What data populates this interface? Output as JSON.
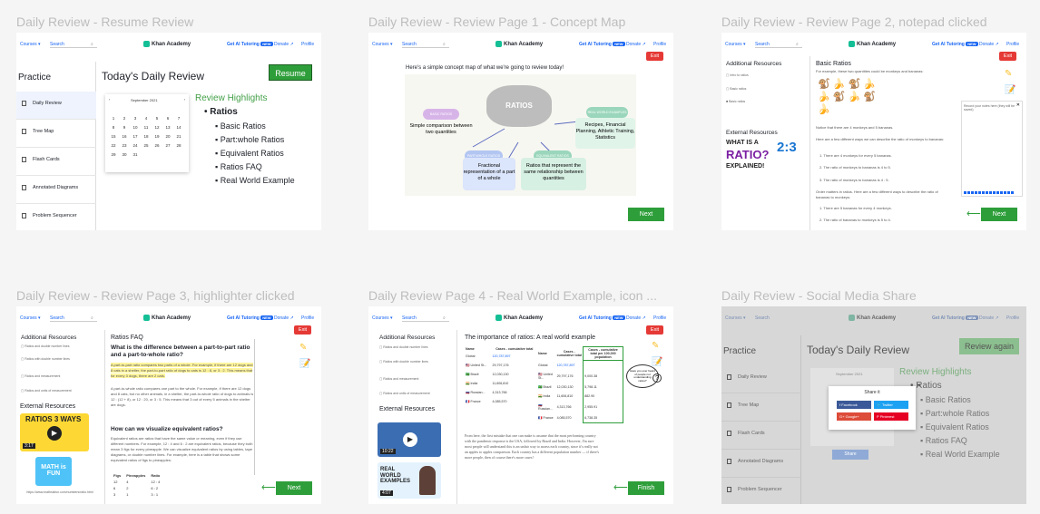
{
  "captions": [
    "Daily Review - Resume Review",
    "Daily Review - Review Page 1 - Concept Map",
    "Daily Review - Review Page 2, notepad clicked",
    "Daily Review - Review Page 3, highlighter clicked",
    "Daily Review Page 4 - Real World Example, icon ...",
    "Daily Review - Social Media Share"
  ],
  "nav": {
    "courses": "Courses ▾",
    "search": "Search",
    "logo": "Khan Academy",
    "ai": "Get AI Tutoring",
    "new": "NEW",
    "donate": "Donate ↗",
    "profile": "Profile"
  },
  "f1": {
    "practice": "Practice",
    "title": "Today's Daily Review",
    "resume": "Resume",
    "side": [
      "Daily Review",
      "Tree Map",
      "Flash Cards",
      "Annotated Diagrams",
      "Problem Sequencer"
    ],
    "month": "September 2021",
    "highlights": "Review Highlights",
    "topic": "Ratios",
    "items": [
      "Basic Ratios",
      "Part:whole Ratios",
      "Equivalent Ratios",
      "Ratios FAQ",
      "Real World Example"
    ],
    "days": [
      "1",
      "2",
      "3",
      "4",
      "5",
      "6",
      "7",
      "8",
      "9",
      "10",
      "11",
      "12",
      "13",
      "14",
      "15",
      "16",
      "17",
      "18",
      "19",
      "20",
      "21",
      "22",
      "23",
      "24",
      "25",
      "26",
      "27",
      "28",
      "29",
      "30",
      "31"
    ]
  },
  "f2": {
    "exit": "Exit",
    "intro": "Here's a simple concept map of what we're going to review today!",
    "center": "RATIOS",
    "n1t": "BASIC RATIOS",
    "n1": "Simple comparison between two quantities",
    "n2t": "PART:WHOLE RATIOS",
    "n2": "Fractional representation of a part of a whole",
    "n3t": "EQUIVALENT RATIOS",
    "n3": "Ratios that represent the same relationship between quantities",
    "n4t": "REAL WORLD EXAMPLES",
    "n4": "Recipes, Financial Planning, Athletic Training, Statistics",
    "next": "Next"
  },
  "f3": {
    "res": "Additional Resources",
    "links": [
      "Intro to ratios",
      "Basic ratios",
      "Basic ratios"
    ],
    "ext": "External Resources",
    "vid1": "WHAT IS A",
    "vid2": "RATIO?",
    "vid3": "EXPLAINED!",
    "vidn": "2:3",
    "title": "Basic Ratios",
    "sub": "For example, these two quantities could be monkeys and bananas:",
    "p1": "Notice that there are 4 monkeys and 5 bananas.",
    "p2": "Here are a few different ways we can describe the ratio of monkeys to bananas:",
    "l1": "1. There are 4 monkeys for every 5 bananas.",
    "l2": "2. The ratio of monkeys to bananas is 4 to 5.",
    "l3": "3. The ratio of monkeys to bananas is 4 : 5.",
    "p3": "Order matters in ratios. Here are a few different ways to describe the ratio of bananas to monkeys:",
    "l4": "1. There are 5 bananas for every 4 monkeys.",
    "l5": "2. The ratio of bananas to monkeys is 5 to 4.",
    "note": "Record your notes here (they will be saved)",
    "exit": "Exit",
    "next": "Next"
  },
  "f4": {
    "res": "Additional Resources",
    "links": [
      "Ratios and double number lines",
      "Ratios with double number lines",
      "Ratios and measurement",
      "Ratios and units of measurement"
    ],
    "ext": "External Resources",
    "vid": "RATIOS 3 WAYS",
    "vidt": "3:17",
    "url": "https://www.mathsisfun.com/numbers/ratio.html",
    "mif": "MATH is FUN",
    "title": "Ratios FAQ",
    "q1": "What is the difference between a part-to-part ratio and a part-to-whole ratio?",
    "a1": "A part-to-part ratio compares two parts of a whole. For example, if there are 12 dogs and 8 cats in a shelter, the part-to-part ratio of dogs to cats is 12 : 8, or 3 : 2. This means that for every 3 dogs, there are 2 cats.",
    "a2": "A part-to-whole ratio compares one part to the whole. For example, if there are 12 dogs and 8 cats, but no other animals, in a shelter, the part-to-whole ratio of dogs to animals is 12 : (12 + 8), or 12 : 20, or 3 : 5. This means that 3 out of every 5 animals in the shelter are dogs.",
    "q2": "How can we visualize equivalent ratios?",
    "a3": "Equivalent ratios are ratios that have the same value or meaning, even if they use different numbers. For example, 12 : 4 and 6 : 2 are equivalent ratios, because they both mean 3 figs for every pineapple. We can visualize equivalent ratios by using tables, tape diagrams, or double number lines. For example, here is a table that shows some equivalent ratios of figs to pineapples:",
    "th": [
      "Figs",
      "Pineapples",
      "Ratio"
    ],
    "rows": [
      [
        "12",
        "4",
        "12 : 4"
      ],
      [
        "6",
        "2",
        "6 : 2"
      ],
      [
        "3",
        "1",
        "3 : 1"
      ]
    ],
    "exit": "Exit",
    "next": "Next"
  },
  "f5": {
    "res": "Additional Resources",
    "links": [
      "Ratios and double number lines",
      "Ratios with double number lines",
      "Ratios and measurement",
      "Ratios and units of measurement"
    ],
    "ext": "External Resources",
    "vidt": "10:22",
    "vid2": "REAL WORLD EXAMPLES",
    "vid2t": "4:07",
    "title": "The importance of ratios: A real world example",
    "th": [
      "Name",
      "Cases - cumulative total",
      "Cases - cumulative total per 100,000 population"
    ],
    "rows": [
      [
        "Global",
        "120,787,897",
        ""
      ],
      [
        "United St...",
        "29,797,176",
        "9,000.38"
      ],
      [
        "Brazil",
        "12,030,130",
        "5,798.11"
      ],
      [
        "India",
        "11,606,810",
        "882.90"
      ],
      [
        "Russian...",
        "4,313,766",
        "2,955.91"
      ],
      [
        "France",
        "4,085,570",
        "6,738.35"
      ]
    ],
    "p1": "From here, the first mistake that one can make is assume that the most performing country with the pandemic response is the USA, followed by Brazil and India. However, I'm sure most people will understand this is an unfair way to assess each country, since it's really not an apples to apples comparison. Each country has a different population number — if there's more people, then of course there's more cases!",
    "bubble": "Have you ever heard of people not understanding ratios?",
    "exit": "Exit",
    "finish": "Finish"
  },
  "f6": {
    "practice": "Practice",
    "title": "Today's Daily Review",
    "again": "Review again",
    "side": [
      "Daily Review",
      "Tree Map",
      "Flash Cards",
      "Annotated Diagrams",
      "Problem Sequencer"
    ],
    "highlights": "Review Highlights",
    "topic": "Ratios",
    "items": [
      "Basic Ratios",
      "Part:whole Ratios",
      "Equivalent Ratios",
      "Ratios FAQ",
      "Real World Example"
    ],
    "share": "Share it",
    "fb": "Facebook",
    "tw": "Twitter",
    "gp": "Google+",
    "pin": "Pinterest",
    "share_btn": "Share",
    "month": "September 2021"
  }
}
